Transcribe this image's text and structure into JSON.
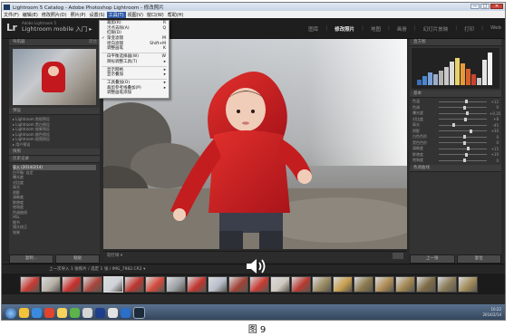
{
  "window": {
    "title": "Lightroom 5 Catalog - Adobe Photoshop Lightroom - 修改照片",
    "minimize": "—",
    "maximize": "□",
    "close": "✕"
  },
  "menubar": {
    "items": [
      {
        "label": "文件(F)"
      },
      {
        "label": "编辑(E)"
      },
      {
        "label": "修改照片(D)"
      },
      {
        "label": "照片(P)"
      },
      {
        "label": "设置(S)"
      },
      {
        "label": "工具(T)",
        "active": true
      },
      {
        "label": "视图(V)"
      },
      {
        "label": "窗口(W)"
      },
      {
        "label": "帮助(H)"
      }
    ]
  },
  "header": {
    "logo": "Lr",
    "identity_sub": "Adobe Lightroom 5",
    "identity_main": "Lightroom mobile 入门 ▸",
    "modules": [
      {
        "label": "图库"
      },
      {
        "label": "修改照片",
        "active": true
      },
      {
        "label": "地图"
      },
      {
        "label": "画册"
      },
      {
        "label": "幻灯片放映"
      },
      {
        "label": "打印"
      },
      {
        "label": "Web"
      }
    ]
  },
  "left_panel": {
    "navigator_title": "导航器",
    "navigator_fit": "适合",
    "presets_title": "预设",
    "presets": [
      "Lightroom 常规预设",
      "Lightroom 黑白预设",
      "Lightroom 效果预设",
      "Lightroom 颜色预设",
      "Lightroom 视频预设",
      "用户预设"
    ],
    "snapshots_title": "快照",
    "history_title": "历史记录",
    "history": [
      "导入 (2014/2/14)",
      "白平衡: 自定",
      "曝光度",
      "对比度",
      "高光",
      "阴影",
      "清晰度",
      "鲜艳度",
      "饱和度",
      "色调曲线",
      "HSL",
      "细节",
      "镜头校正",
      "效果"
    ],
    "copy_button": "复制...",
    "paste_button": "粘贴"
  },
  "toolbar": {
    "text": "软打样 ▾"
  },
  "right_panel": {
    "histogram_title": "直方图",
    "basic_title": "基本",
    "sliders": [
      {
        "label": "色温",
        "value": "+12",
        "pos": 0.55
      },
      {
        "label": "色调",
        "value": "0",
        "pos": 0.5
      },
      {
        "label": "曝光度",
        "value": "+0.35",
        "pos": 0.56
      },
      {
        "label": "对比度",
        "value": "+8",
        "pos": 0.53
      },
      {
        "label": "高光",
        "value": "-45",
        "pos": 0.28
      },
      {
        "label": "阴影",
        "value": "+30",
        "pos": 0.65
      },
      {
        "label": "白色色阶",
        "value": "0",
        "pos": 0.5
      },
      {
        "label": "黑色色阶",
        "value": "0",
        "pos": 0.5
      },
      {
        "label": "清晰度",
        "value": "+15",
        "pos": 0.58
      },
      {
        "label": "鲜艳度",
        "value": "+10",
        "pos": 0.55
      },
      {
        "label": "饱和度",
        "value": "0",
        "pos": 0.5
      }
    ],
    "tone_curve_title": "色调曲线",
    "previous_button": "上一张",
    "reset_button": "复位"
  },
  "filmstrip": {
    "info": "上一次导入   1 张照片 / 选定 1 张 / IMG_7982.CR2 ▾",
    "filter": "过滤器: 关闭过滤器"
  },
  "menu": {
    "items": [
      {
        "label": "裁剪(R)",
        "key": "R"
      },
      {
        "label": "污点去除(A)",
        "key": "Q"
      },
      {
        "label": "红眼(D)"
      },
      {
        "label": "渐变滤镜",
        "key": "M",
        "checked": true
      },
      {
        "label": "径向滤镜",
        "key": "Shift+M"
      },
      {
        "label": "调整画笔",
        "key": "K"
      },
      {
        "sep": true
      },
      {
        "label": "白平衡选择器(W)",
        "key": "W"
      },
      {
        "label": "目标调整工具(T)",
        "key": "▸"
      },
      {
        "sep": true
      },
      {
        "label": "显示网格",
        "key": "▸"
      },
      {
        "label": "显示叠加",
        "key": "▸"
      },
      {
        "sep": true
      },
      {
        "label": "工具叠加(O)",
        "key": "▸"
      },
      {
        "label": "裁剪参考线叠加(P)",
        "key": "▸"
      },
      {
        "label": "调整画笔添加"
      }
    ]
  },
  "taskbar": {
    "time": "10:22",
    "date": "2014/2/14"
  },
  "caption": "图 9",
  "colors": {
    "lr_background": "#2a2a2a",
    "jacket_red": "#d0211f",
    "menu_highlight": "#2c5aa8"
  }
}
